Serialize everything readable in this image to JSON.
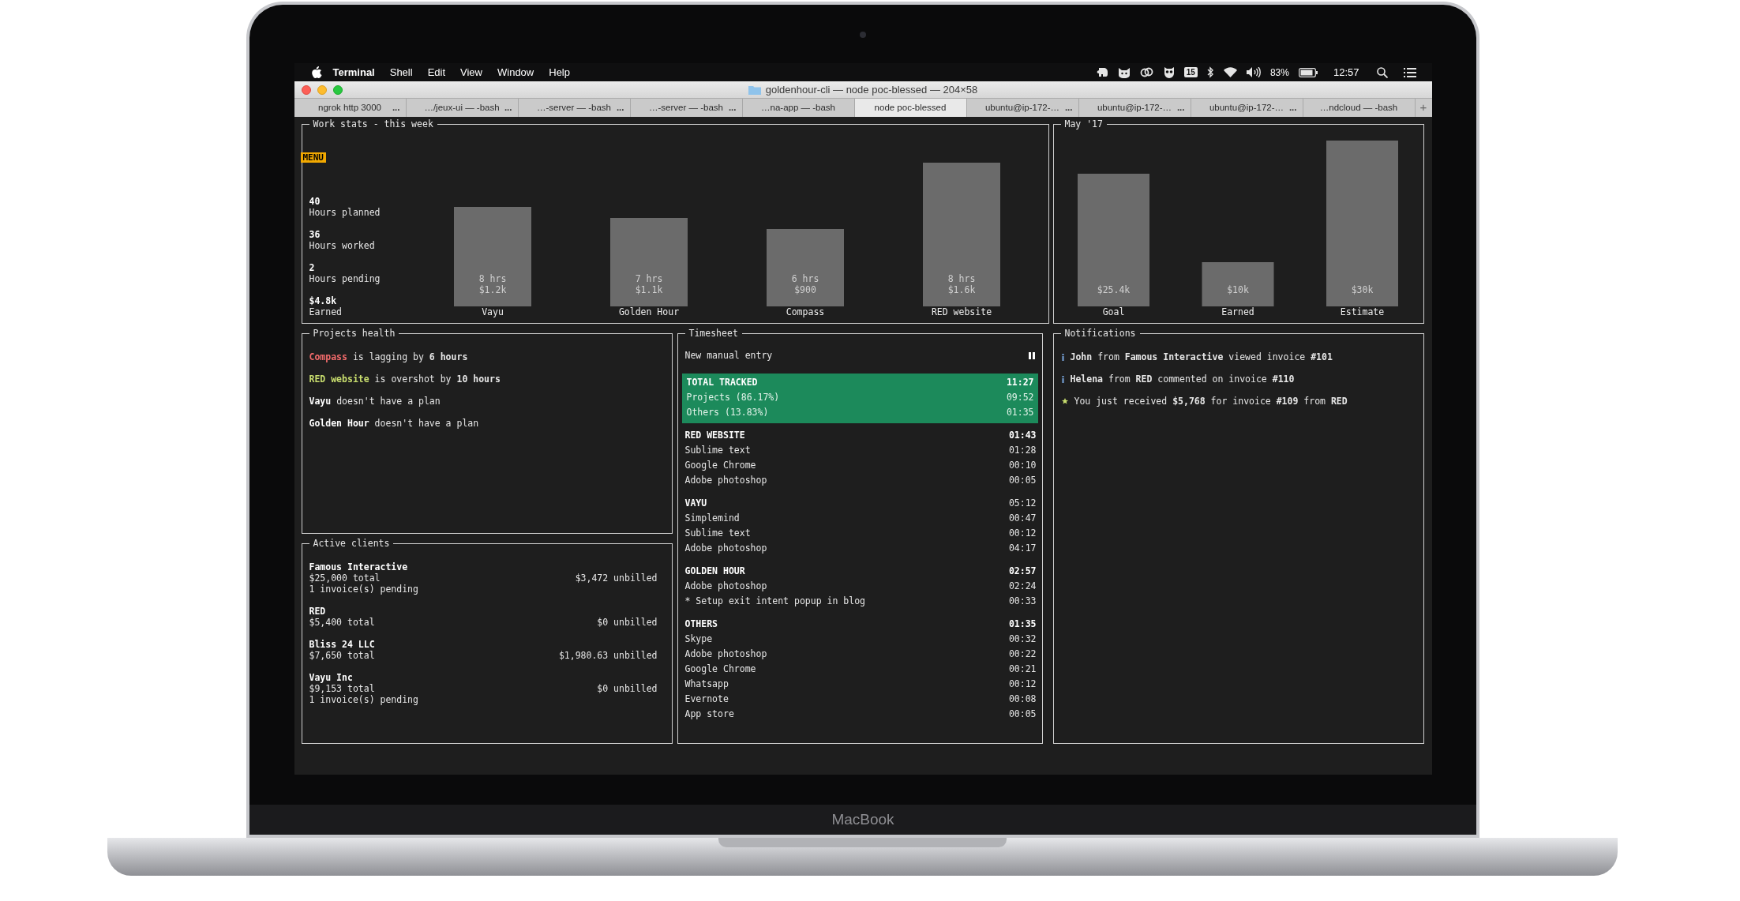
{
  "menu_bar": {
    "app": "Terminal",
    "menus": [
      "Shell",
      "Edit",
      "View",
      "Window",
      "Help"
    ],
    "calendar_badge": "15",
    "battery": "83%",
    "clock": "12:57"
  },
  "window": {
    "title": "goldenhour-cli — node poc-blessed — 204×58",
    "new_tab_button": "+",
    "tabs": [
      {
        "label": "ngrok http 3000",
        "activity": "...",
        "selected": false
      },
      {
        "label": "…/jeux-ui — -bash",
        "activity": "...",
        "selected": false
      },
      {
        "label": "…-server — -bash",
        "activity": "...",
        "selected": false
      },
      {
        "label": "…-server — -bash",
        "activity": "...",
        "selected": false
      },
      {
        "label": "…na-app — -bash",
        "selected": false
      },
      {
        "label": "node poc-blessed",
        "selected": true
      },
      {
        "label": "ubuntu@ip-172-…",
        "activity": "...",
        "selected": false
      },
      {
        "label": "ubuntu@ip-172-…",
        "activity": "...",
        "selected": false
      },
      {
        "label": "ubuntu@ip-172-…",
        "activity": "...",
        "selected": false
      },
      {
        "label": "…ndcloud — -bash",
        "selected": false
      }
    ]
  },
  "work_stats": {
    "title": "Work stats - this week",
    "menu_button": "MENU",
    "stats": [
      {
        "value": "40",
        "label": "Hours planned"
      },
      {
        "value": "36",
        "label": "Hours worked"
      },
      {
        "value": "2",
        "label": "Hours pending"
      },
      {
        "value": "$4.8k",
        "label": "Earned"
      }
    ],
    "bars": [
      {
        "label": "Vayu",
        "hours": "8 hrs",
        "amount": "$1.2k"
      },
      {
        "label": "Golden Hour",
        "hours": "7 hrs",
        "amount": "$1.1k"
      },
      {
        "label": "Compass",
        "hours": "6 hrs",
        "amount": "$900"
      },
      {
        "label": "RED website",
        "hours": "8 hrs",
        "amount": "$1.6k"
      }
    ]
  },
  "monthly": {
    "title": "May '17",
    "bars": [
      {
        "label": "Goal",
        "amount": "$25.4k"
      },
      {
        "label": "Earned",
        "amount": "$10k"
      },
      {
        "label": "Estimate",
        "amount": "$30k"
      }
    ]
  },
  "projects_health": {
    "title": "Projects health",
    "items": [
      {
        "project": "Compass",
        "status": "is lagging by **6 hours**",
        "color": "#f26b6b"
      },
      {
        "project": "RED website",
        "status": "is overshot by **10 hours**",
        "color": "#c8dd6e"
      },
      {
        "project": "Vayu",
        "status": "doesn't have a plan",
        "color": "#ffffff"
      },
      {
        "project": "Golden Hour",
        "status": "doesn't have a plan",
        "color": "#ffffff"
      }
    ]
  },
  "active_clients": {
    "title": "Active clients",
    "clients": [
      {
        "name": "Famous Interactive",
        "total": "$25,000 total",
        "unbilled": "$3,472 unbilled",
        "pending": "1 invoice(s) pending"
      },
      {
        "name": "RED",
        "total": "$5,400 total",
        "unbilled": "$0 unbilled"
      },
      {
        "name": "Bliss 24 LLC",
        "total": "$7,650 total",
        "unbilled": "$1,980.63 unbilled"
      },
      {
        "name": "Vayu Inc",
        "total": "$9,153 total",
        "unbilled": "$0 unbilled",
        "pending": "1 invoice(s) pending"
      }
    ]
  },
  "timesheet": {
    "title": "Timesheet",
    "new_entry": "New manual entry",
    "summary": [
      {
        "kind": "total",
        "label": "TOTAL TRACKED",
        "time": "11:27"
      },
      {
        "kind": "part",
        "label": "Projects (86.17%)",
        "time": "09:52"
      },
      {
        "kind": "part",
        "label": "Others (13.83%)",
        "time": "01:35"
      }
    ],
    "groups": [
      {
        "name": "RED WEBSITE",
        "time": "01:43",
        "time_bold": true,
        "entries": [
          {
            "label": "Sublime text",
            "time": "01:28"
          },
          {
            "label": "Google Chrome",
            "time": "00:10"
          },
          {
            "label": "Adobe photoshop",
            "time": "00:05"
          }
        ]
      },
      {
        "name": "VAYU",
        "time": "05:12",
        "time_bold": false,
        "entries": [
          {
            "label": "Simplemind",
            "time": "00:47"
          },
          {
            "label": "Sublime text",
            "time": "00:12"
          },
          {
            "label": "Adobe photoshop",
            "time": "04:17"
          }
        ]
      },
      {
        "name": "GOLDEN HOUR",
        "time": "02:57",
        "time_bold": true,
        "entries": [
          {
            "label": "Adobe photoshop",
            "time": "02:24"
          },
          {
            "label": "* Setup exit intent popup in blog",
            "time": "00:33"
          }
        ]
      },
      {
        "name": "OTHERS",
        "time": "01:35",
        "time_bold": true,
        "entries": [
          {
            "label": "Skype",
            "time": "00:32"
          },
          {
            "label": "Adobe photoshop",
            "time": "00:22"
          },
          {
            "label": "Google Chrome",
            "time": "00:21"
          },
          {
            "label": "Whatsapp",
            "time": "00:12"
          },
          {
            "label": "Evernote",
            "time": "00:08"
          },
          {
            "label": "App store",
            "time": "00:05"
          }
        ]
      }
    ]
  },
  "notifications": {
    "title": "Notifications",
    "items": [
      {
        "kind": "info",
        "text": "**John** from **Famous Interactive** viewed invoice **#101**"
      },
      {
        "kind": "info",
        "text": "**Helena** from **RED** commented on invoice **#110**"
      },
      {
        "kind": "payment",
        "text": "You just received **$5,768** for invoice **#109** from **RED**"
      }
    ]
  },
  "device_label": "MacBook"
}
